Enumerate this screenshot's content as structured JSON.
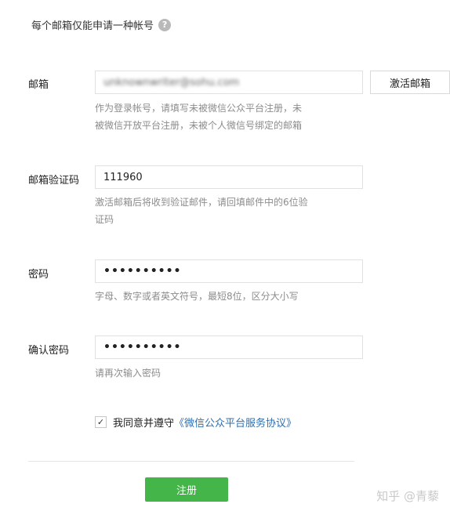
{
  "header": {
    "text": "每个邮箱仅能申请一种帐号",
    "help_icon": "?"
  },
  "email": {
    "label": "邮箱",
    "value": "unknownwriter@sohu.com",
    "activate_label": "激活邮箱",
    "hint_line1": "作为登录帐号，请填写未被微信公众平台注册，未",
    "hint_line2": "被微信开放平台注册，未被个人微信号绑定的邮箱"
  },
  "code": {
    "label": "邮箱验证码",
    "value": "111960",
    "hint_line1": "激活邮箱后将收到验证邮件，请回填邮件中的6位验",
    "hint_line2": "证码"
  },
  "password": {
    "label": "密码",
    "value": "••••••••••",
    "hint": "字母、数字或者英文符号，最短8位，区分大小写"
  },
  "confirm": {
    "label": "确认密码",
    "value": "••••••••••",
    "hint": "请再次输入密码"
  },
  "agreement": {
    "check": "✓",
    "prefix": "我同意并遵守",
    "link": "《微信公众平台服务协议》"
  },
  "register_label": "注册",
  "watermark": "知乎 @青藜"
}
